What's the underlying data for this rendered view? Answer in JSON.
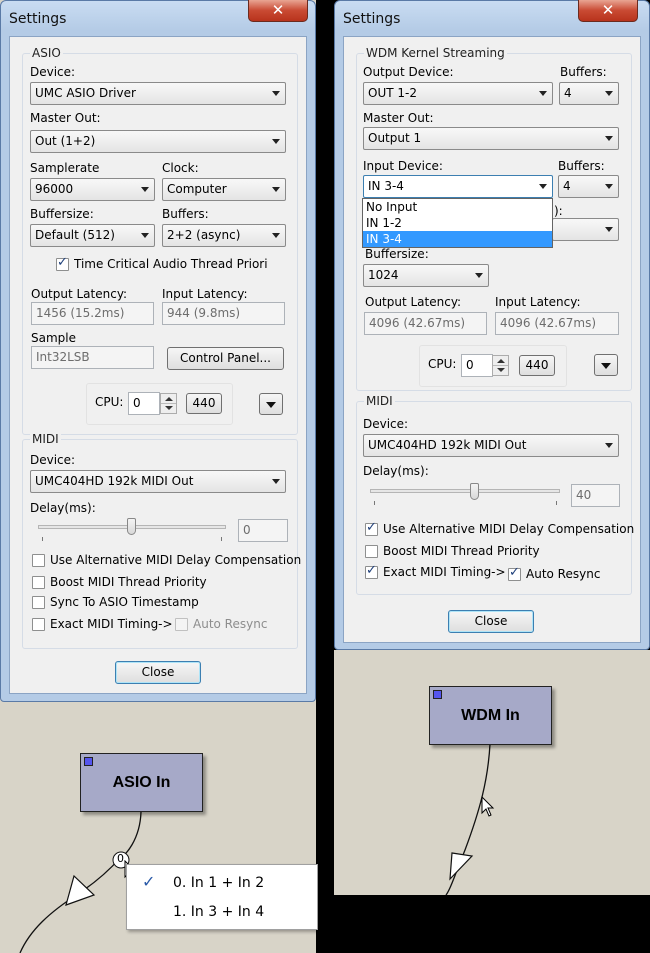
{
  "asio_window": {
    "title": "Settings",
    "asio_group": {
      "title": "ASIO",
      "device_label": "Device:",
      "device_value": "UMC ASIO Driver",
      "master_out_label": "Master Out:",
      "master_out_value": "Out (1+2)",
      "samplerate_label": "Samplerate",
      "samplerate_value": "96000",
      "clock_label": "Clock:",
      "clock_value": "Computer",
      "buffersize_label": "Buffersize:",
      "buffersize_value": "Default (512)",
      "buffers_label": "Buffers:",
      "buffers_value": "2+2 (async)",
      "time_critical_label": "Time Critical Audio Thread Priority",
      "output_latency_label": "Output Latency:",
      "output_latency_value": "1456 (15.2ms)",
      "input_latency_label": "Input Latency:",
      "input_latency_value": "944 (9.8ms)",
      "sample_label": "Sample",
      "sample_value": "Int32LSB",
      "control_panel_label": "Control Panel...",
      "cpu_label": "CPU:",
      "cpu_value": "0",
      "cpu_button": "440"
    },
    "midi_group": {
      "title": "MIDI",
      "device_label": "Device:",
      "device_value": "UMC404HD 192k MIDI Out",
      "delay_label": "Delay(ms):",
      "delay_value": "0",
      "delay_slider": 0.5,
      "alt_delay_label": "Use Alternative MIDI Delay Compensation",
      "boost_label": "Boost MIDI Thread Priority",
      "sync_label": "Sync To ASIO Timestamp",
      "exact_timing_label": "Exact MIDI Timing->",
      "auto_resync_label": "Auto Resync"
    },
    "close_label": "Close"
  },
  "wdm_window": {
    "title": "Settings",
    "wdm_group": {
      "title": "WDM Kernel Streaming",
      "output_device_label": "Output Device:",
      "output_device_value": "OUT 1-2",
      "buffers_label": "Buffers:",
      "buffers_value": "4",
      "master_out_label": "Master Out:",
      "master_out_value": "Output 1",
      "input_device_label": "Input Device:",
      "input_device_value": "IN 3-4",
      "input_buffers_label": "Buffers:",
      "input_buffers_value": "4",
      "input_options": [
        "No Input",
        "IN 1-2",
        "IN 3-4"
      ],
      "partial_label": "):",
      "buffersize_label": "Buffersize:",
      "buffersize_value": "1024",
      "output_latency_label": "Output Latency:",
      "output_latency_value": "4096 (42.67ms)",
      "input_latency_label": "Input Latency:",
      "input_latency_value": "4096 (42.67ms)",
      "cpu_label": "CPU:",
      "cpu_value": "0",
      "cpu_button": "440"
    },
    "midi_group": {
      "title": "MIDI",
      "device_label": "Device:",
      "device_value": "UMC404HD 192k MIDI Out",
      "delay_label": "Delay(ms):",
      "delay_value": "40",
      "delay_slider": 0.55,
      "alt_delay_label": "Use Alternative MIDI Delay Compensation",
      "boost_label": "Boost MIDI Thread Priority",
      "exact_timing_label": "Exact MIDI Timing->",
      "auto_resync_label": "Auto Resync"
    },
    "close_label": "Close"
  },
  "canvas": {
    "asio_node_label": "ASIO In",
    "wdm_node_label": "WDM In",
    "pin_marker": "0",
    "context_menu": [
      "0. In 1 + In 2",
      "1. In 3 + In 4"
    ]
  },
  "colors": {
    "node_fill": "#a6a9c8",
    "pin_fill": "#5555ee",
    "selection": "#3399ff"
  }
}
